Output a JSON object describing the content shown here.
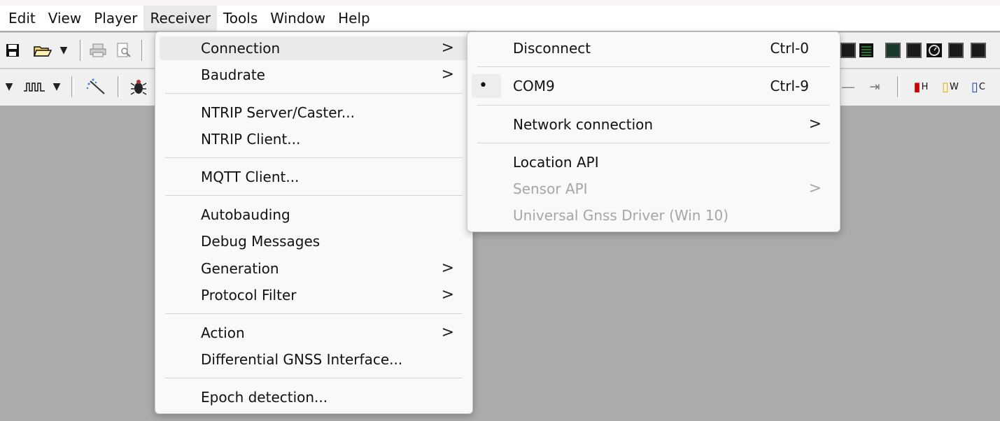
{
  "menubar": {
    "items": [
      "Edit",
      "View",
      "Player",
      "Receiver",
      "Tools",
      "Window",
      "Help"
    ]
  },
  "toolbar2": {
    "thermometers": [
      "H",
      "W",
      "C"
    ]
  },
  "receiver_menu": {
    "items": [
      {
        "label": "Connection",
        "submenu": true
      },
      {
        "label": "Baudrate",
        "submenu": true
      },
      {
        "label": "NTRIP Server/Caster...",
        "submenu": false
      },
      {
        "label": "NTRIP Client...",
        "submenu": false
      },
      {
        "label": "MQTT Client...",
        "submenu": false
      },
      {
        "label": "Autobauding",
        "submenu": false
      },
      {
        "label": "Debug Messages",
        "submenu": false
      },
      {
        "label": "Generation",
        "submenu": true
      },
      {
        "label": "Protocol Filter",
        "submenu": true
      },
      {
        "label": "Action",
        "submenu": true
      },
      {
        "label": "Differential GNSS Interface...",
        "submenu": false
      },
      {
        "label": "Epoch detection...",
        "submenu": false
      }
    ],
    "arrow": ">"
  },
  "connection_menu": {
    "items": [
      {
        "label": "Disconnect",
        "shortcut": "Ctrl-0"
      },
      {
        "label": "COM9",
        "shortcut": "Ctrl-9",
        "selected": true
      },
      {
        "label": "Network connection",
        "submenu": true
      },
      {
        "label": "Location API"
      },
      {
        "label": "Sensor API",
        "submenu": true,
        "disabled": true
      },
      {
        "label": "Universal Gnss Driver (Win 10)",
        "disabled": true
      }
    ],
    "arrow": ">"
  },
  "colors": {
    "workspace": "#ababab",
    "menu_bg": "#f9f9f9",
    "hover": "#eaeaea",
    "disabled_text": "#a6a6a6"
  }
}
